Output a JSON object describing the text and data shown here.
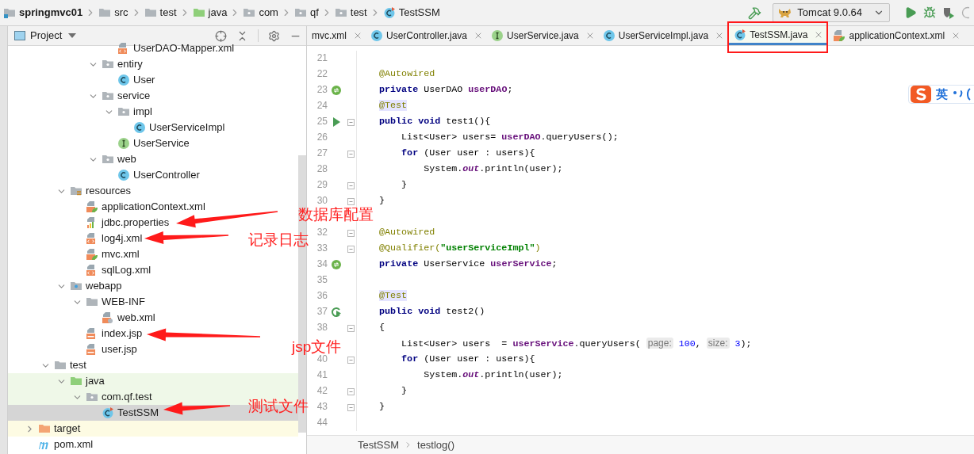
{
  "breadcrumbs": [
    {
      "label": "springmvc01",
      "kind": "module"
    },
    {
      "label": "src",
      "kind": "folder"
    },
    {
      "label": "test",
      "kind": "folder"
    },
    {
      "label": "java",
      "kind": "test-root"
    },
    {
      "label": "com",
      "kind": "package"
    },
    {
      "label": "qf",
      "kind": "package"
    },
    {
      "label": "test",
      "kind": "package"
    },
    {
      "label": "TestSSM",
      "kind": "test-class"
    }
  ],
  "run_config": {
    "label": "Tomcat 9.0.64"
  },
  "project_panel": {
    "title": "Project"
  },
  "tree": [
    {
      "children": [
        {
          "children": [
            {
              "children": [
                {
                  "children": [
                    {
                      "children": [
                        {
                          "children": [
                            {
                              "label": "UserDAO-Mapper.xml",
                              "kind": "xml",
                              "selected": false
                            }
                          ]
                        },
                        {
                          "label": "entiry",
                          "kind": "package",
                          "expanded": true,
                          "selected": false,
                          "children": [
                            {
                              "label": "User",
                              "kind": "class",
                              "selected": false
                            }
                          ]
                        },
                        {
                          "label": "service",
                          "kind": "package",
                          "expanded": true,
                          "selected": false,
                          "children": [
                            {
                              "label": "impl",
                              "kind": "package",
                              "expanded": true,
                              "selected": false,
                              "children": [
                                {
                                  "label": "UserServiceImpl",
                                  "kind": "class",
                                  "selected": false
                                }
                              ]
                            },
                            {
                              "label": "UserService",
                              "kind": "interface",
                              "selected": false
                            }
                          ]
                        },
                        {
                          "label": "web",
                          "kind": "package",
                          "expanded": true,
                          "selected": false,
                          "children": [
                            {
                              "label": "UserController",
                              "kind": "class",
                              "selected": false
                            }
                          ]
                        }
                      ]
                    }
                  ]
                },
                {
                  "label": "resources",
                  "kind": "resource-folder",
                  "expanded": true,
                  "selected": false,
                  "children": [
                    {
                      "label": "applicationContext.xml",
                      "kind": "spring-xml",
                      "selected": false
                    },
                    {
                      "label": "jdbc.properties",
                      "kind": "properties",
                      "selected": false
                    },
                    {
                      "label": "log4j.xml",
                      "kind": "xml",
                      "selected": false
                    },
                    {
                      "label": "mvc.xml",
                      "kind": "spring-xml",
                      "selected": false
                    },
                    {
                      "label": "sqlLog.xml",
                      "kind": "xml",
                      "selected": false
                    }
                  ]
                },
                {
                  "label": "webapp",
                  "kind": "web-folder",
                  "expanded": true,
                  "selected": false,
                  "children": [
                    {
                      "label": "WEB-INF",
                      "kind": "folder",
                      "expanded": true,
                      "selected": false,
                      "children": [
                        {
                          "label": "web.xml",
                          "kind": "web-xml",
                          "selected": false
                        }
                      ]
                    },
                    {
                      "label": "index.jsp",
                      "kind": "jsp",
                      "selected": false
                    },
                    {
                      "label": "user.jsp",
                      "kind": "jsp",
                      "selected": false
                    }
                  ]
                }
              ]
            },
            {
              "label": "test",
              "kind": "folder",
              "expanded": true,
              "selected": false,
              "children": [
                {
                  "label": "java",
                  "kind": "test-root",
                  "expanded": true,
                  "selected": false,
                  "children": [
                    {
                      "label": "com.qf.test",
                      "kind": "test-package",
                      "expanded": true,
                      "selected": false,
                      "children": [
                        {
                          "label": "TestSSM",
                          "kind": "test-class",
                          "selected": true
                        }
                      ]
                    }
                  ]
                }
              ]
            }
          ]
        },
        {
          "label": "target",
          "kind": "excluded-folder",
          "expanded": false,
          "selected": false
        },
        {
          "label": "pom.xml",
          "kind": "maven",
          "selected": false
        }
      ]
    }
  ],
  "tabs": [
    {
      "label": "mvc.xml",
      "selected": false,
      "marked": false
    },
    {
      "label": "UserController.java",
      "kind": "class",
      "selected": false,
      "marked": false
    },
    {
      "label": "UserService.java",
      "kind": "interface",
      "selected": false,
      "marked": false
    },
    {
      "label": "UserServiceImpl.java",
      "kind": "class",
      "selected": false,
      "marked": false
    },
    {
      "label": "TestSSM.java",
      "kind": "test-class",
      "selected": true,
      "marked": true
    },
    {
      "label": "applicationContext.xml",
      "kind": "spring-xml",
      "selected": false,
      "marked": false
    }
  ],
  "code_lines": [
    {
      "number": "21",
      "fold": false
    },
    {
      "number": "22",
      "fold": false,
      "tokens": [
        {
          "text": "    @Autowired",
          "kind": "annotation"
        }
      ]
    },
    {
      "number": "23",
      "gutter": {
        "kind": "bean"
      },
      "fold": false,
      "tokens": [
        {
          "text": "    private",
          "kind": "keyword"
        },
        {
          "text": " UserDAO "
        },
        {
          "text": "userDAO",
          "kind": "field"
        },
        {
          "text": ";"
        }
      ]
    },
    {
      "number": "24",
      "fold": false,
      "tokens": [
        {
          "text": "    @Test",
          "kind": "annotation-highlight"
        }
      ]
    },
    {
      "number": "25",
      "gutter": {
        "kind": "run"
      },
      "fold": true,
      "tokens": [
        {
          "text": "    public void",
          "kind": "keyword"
        },
        {
          "text": " test1(){"
        }
      ]
    },
    {
      "number": "26",
      "fold": false,
      "tokens": [
        {
          "text": "        List<User> users= "
        },
        {
          "text": "userDAO",
          "kind": "field"
        },
        {
          "text": ".queryUsers();"
        }
      ]
    },
    {
      "number": "27",
      "fold": true,
      "tokens": [
        {
          "text": "        for",
          "kind": "keyword"
        },
        {
          "text": " (User user : users){"
        }
      ]
    },
    {
      "number": "28",
      "fold": false,
      "tokens": [
        {
          "text": "            System."
        },
        {
          "text": "out",
          "kind": "static"
        },
        {
          "text": ".println(user);"
        }
      ]
    },
    {
      "number": "29",
      "fold": true,
      "tokens": [
        {
          "text": "        }"
        }
      ]
    },
    {
      "number": "30",
      "fold": true,
      "tokens": [
        {
          "text": "    }"
        }
      ]
    },
    {
      "fold": false
    },
    {
      "number": "32",
      "fold": true,
      "tokens": [
        {
          "text": "    @Autowired",
          "kind": "annotation"
        }
      ]
    },
    {
      "number": "33",
      "fold": true,
      "tokens": [
        {
          "text": "    @Qualifier(",
          "kind": "annotation"
        },
        {
          "text": "\"userServiceImpl\"",
          "kind": "string"
        },
        {
          "text": ")",
          "kind": "annotation"
        }
      ]
    },
    {
      "number": "34",
      "gutter": {
        "kind": "bean"
      },
      "fold": false,
      "tokens": [
        {
          "text": "    private",
          "kind": "keyword"
        },
        {
          "text": " UserService "
        },
        {
          "text": "userService",
          "kind": "field"
        },
        {
          "text": ";"
        }
      ]
    },
    {
      "number": "35",
      "fold": false
    },
    {
      "number": "36",
      "fold": false,
      "tokens": [
        {
          "text": "    @Test",
          "kind": "annotation-highlight"
        }
      ]
    },
    {
      "number": "37",
      "gutter": {
        "kind": "run-loop"
      },
      "fold": false,
      "tokens": [
        {
          "text": "    public void",
          "kind": "keyword"
        },
        {
          "text": " test2()"
        }
      ]
    },
    {
      "number": "38",
      "fold": true,
      "tokens": [
        {
          "text": "    {"
        }
      ]
    },
    {
      "fold": false,
      "tokens": [
        {
          "text": "        List<User> users  = "
        },
        {
          "text": "userService",
          "kind": "field"
        },
        {
          "text": ".queryUsers( "
        },
        {
          "text": "page:",
          "kind": "hint"
        },
        {
          "text": " 100",
          "kind": "number"
        },
        {
          "text": ", "
        },
        {
          "text": "size:",
          "kind": "hint"
        },
        {
          "text": " 3",
          "kind": "number"
        },
        {
          "text": ");"
        }
      ]
    },
    {
      "number": "40",
      "fold": true,
      "tokens": [
        {
          "text": "        for",
          "kind": "keyword"
        },
        {
          "text": " (User user : users){"
        }
      ]
    },
    {
      "number": "41",
      "fold": false,
      "tokens": [
        {
          "text": "            System."
        },
        {
          "text": "out",
          "kind": "static"
        },
        {
          "text": ".println(user);"
        }
      ]
    },
    {
      "number": "42",
      "fold": true,
      "tokens": [
        {
          "text": "        }"
        }
      ]
    },
    {
      "number": "43",
      "fold": true,
      "tokens": [
        {
          "text": "    }"
        }
      ]
    },
    {
      "number": "44",
      "fold": false
    }
  ],
  "editor_breadcrumbs": [
    {
      "label": "TestSSM"
    },
    {
      "label": "testlog()"
    }
  ],
  "ime": {
    "mode": "英"
  },
  "annotations": [
    {
      "text": "数据库配置"
    },
    {
      "text": "记录日志"
    },
    {
      "text": "jsp文件"
    },
    {
      "text": "测试文件"
    }
  ]
}
